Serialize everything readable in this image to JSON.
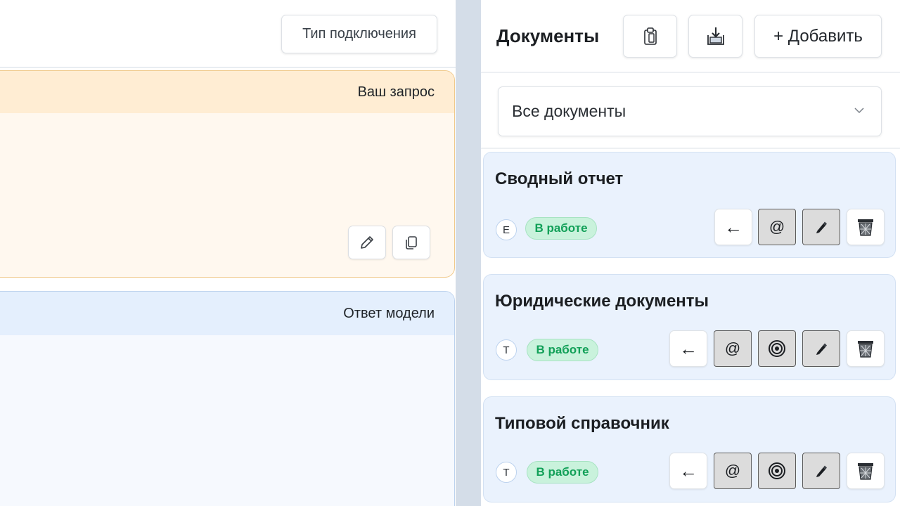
{
  "left": {
    "connection_button": "Тип подключения",
    "request_card": {
      "header": "Ваш запрос"
    },
    "response_card": {
      "header": "Ответ модели"
    }
  },
  "documents": {
    "title": "Документы",
    "add_button": "+ Добавить",
    "filter_selected": "Все документы",
    "items": [
      {
        "title": "Сводный отчет",
        "avatar": "Е",
        "status": "В работе",
        "actions": [
          "←",
          "@"
        ]
      },
      {
        "title": "Юридические документы",
        "avatar": "Т",
        "status": "В работе",
        "actions": [
          "←",
          "@"
        ]
      },
      {
        "title": "Типовой справочник",
        "avatar": "Т",
        "status": "В работе",
        "actions": [
          "←",
          "@"
        ]
      }
    ]
  },
  "colors": {
    "request_bg": "#fff8ef",
    "request_header": "#ffedd3",
    "response_bg": "#f6f9fe",
    "response_header": "#e4effd",
    "doc_card_bg": "#eaf2fd",
    "status_bg": "#c9f2dc",
    "status_text": "#12a058",
    "divider": "#d4dde8"
  },
  "icons": {
    "edit": "pencil-icon",
    "copy": "copy-icon",
    "clipboard": "clipboard-icon",
    "download": "download-icon",
    "chevron": "chevron-down-icon",
    "target": "target-icon",
    "marker": "marker-icon",
    "trash": "trash-icon"
  }
}
